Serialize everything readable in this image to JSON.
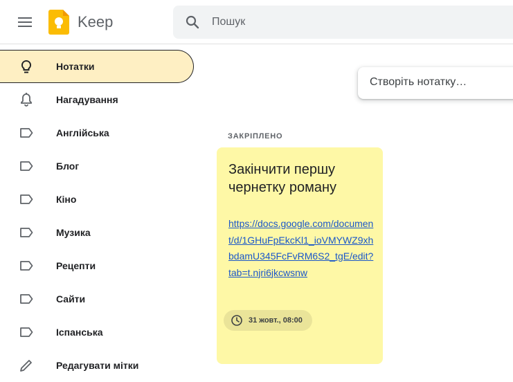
{
  "header": {
    "app_title": "Keep",
    "search_placeholder": "Пошук"
  },
  "sidebar": {
    "items": [
      {
        "label": "Нотатки",
        "icon": "lightbulb-icon",
        "active": true
      },
      {
        "label": "Нагадування",
        "icon": "bell-icon"
      },
      {
        "label": "Англійська",
        "icon": "label-icon"
      },
      {
        "label": "Блог",
        "icon": "label-icon"
      },
      {
        "label": "Кіно",
        "icon": "label-icon"
      },
      {
        "label": "Музика",
        "icon": "label-icon"
      },
      {
        "label": "Рецепти",
        "icon": "label-icon"
      },
      {
        "label": "Сайти",
        "icon": "label-icon"
      },
      {
        "label": "Іспанська",
        "icon": "label-icon"
      },
      {
        "label": "Редагувати мітки",
        "icon": "pencil-icon"
      }
    ]
  },
  "main": {
    "take_note_placeholder": "Створіть нотатку…",
    "pinned_label": "ЗАКРІПЛЕНО",
    "note": {
      "title": "Закінчити першу чернетку роману",
      "link": "https://docs.google.com/document/d/1GHuFpEkcKl1_ioVMYWZ9xhbdamU345FcFvRM6S2_tgE/edit?tab=t.njri6jkcwsnw",
      "reminder": "31 жовт., 08:00",
      "color": "#fef8a6"
    }
  }
}
